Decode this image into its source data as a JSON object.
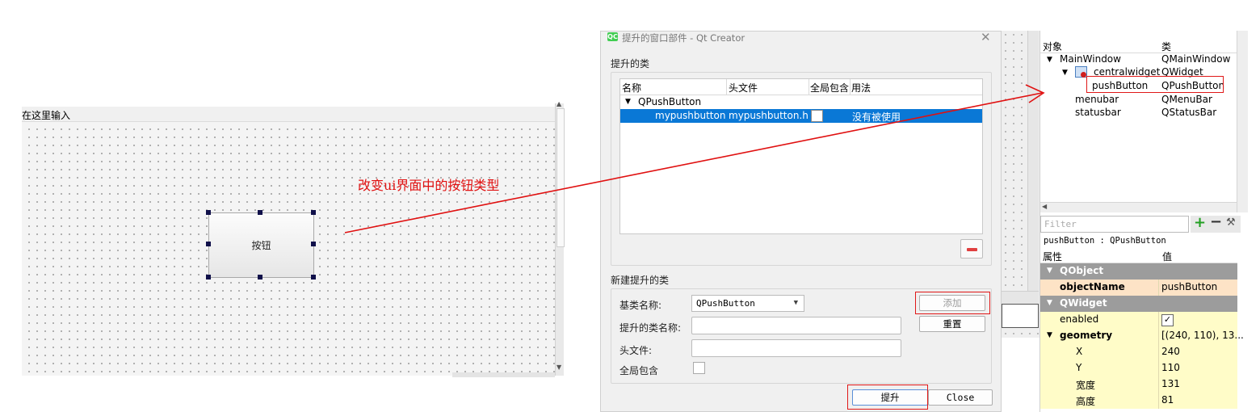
{
  "form": {
    "menubar_placeholder": "在这里输入",
    "push_button_text": "按钮"
  },
  "annotation": {
    "text": "改变ui界面中的按钮类型",
    "color": "#e01010"
  },
  "dialog": {
    "title": "提升的窗口部件 - Qt Creator",
    "logo_text": "QC",
    "close_glyph": "✕",
    "promoted_classes_label": "提升的类",
    "columns": [
      "名称",
      "头文件",
      "全局包含",
      "用法"
    ],
    "group_row": {
      "name": "QPushButton"
    },
    "rows": [
      {
        "name": "mypushbutton",
        "header": "mypushbutton.h",
        "global": false,
        "usage": "没有被使用",
        "selected": true
      }
    ],
    "new_promoted_label": "新建提升的类",
    "base_class_label": "基类名称:",
    "base_class_value": "QPushButton",
    "promoted_class_label": "提升的类名称:",
    "promoted_class_value": "",
    "header_file_label": "头文件:",
    "header_file_value": "",
    "global_include_label": "全局包含",
    "add_button": "添加",
    "reset_button": "重置",
    "promote_button": "提升",
    "close_button": "Close",
    "accent_color": "#0a78d6"
  },
  "object_inspector": {
    "columns": [
      "对象",
      "类"
    ],
    "tree": [
      {
        "object": "MainWindow",
        "class": "QMainWindow"
      },
      {
        "object": "centralwidget",
        "class": "QWidget"
      },
      {
        "object": "pushButton",
        "class": "QPushButton"
      },
      {
        "object": "menubar",
        "class": "QMenuBar"
      },
      {
        "object": "statusbar",
        "class": "QStatusBar"
      }
    ]
  },
  "property_editor": {
    "filter_placeholder": "Filter",
    "selected_object": "pushButton : QPushButton",
    "columns": [
      "属性",
      "值"
    ],
    "rows": [
      {
        "name": "QObject",
        "value": "",
        "type": "category"
      },
      {
        "name": "objectName",
        "value": "pushButton",
        "type": "orange",
        "bold": true
      },
      {
        "name": "QWidget",
        "value": "",
        "type": "category"
      },
      {
        "name": "enabled",
        "value": "✓",
        "type": "yellow"
      },
      {
        "name": "geometry",
        "value": "[(240, 110), 13...",
        "type": "yellow",
        "bold": true
      },
      {
        "name": "X",
        "value": "240",
        "type": "yellow"
      },
      {
        "name": "Y",
        "value": "110",
        "type": "yellow"
      },
      {
        "name": "宽度",
        "value": "131",
        "type": "yellow"
      },
      {
        "name": "高度",
        "value": "81",
        "type": "yellow"
      }
    ]
  }
}
